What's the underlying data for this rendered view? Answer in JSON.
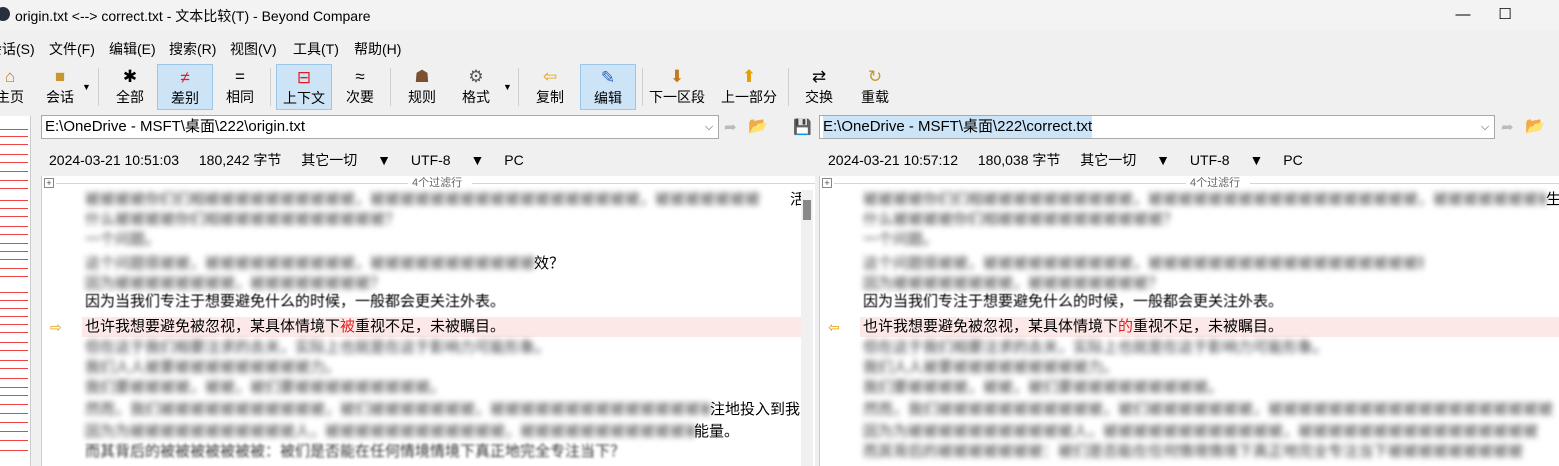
{
  "window": {
    "title": "origin.txt <--> correct.txt - 文本比较(T) - Beyond Compare",
    "minimize": "—",
    "maximize": "☐"
  },
  "menu": [
    "会话(S)",
    "文件(F)",
    "编辑(E)",
    "搜索(R)",
    "视图(V)",
    "工具(T)",
    "帮助(H)"
  ],
  "toolbar": {
    "home": "主页",
    "session": "会话",
    "all": "全部",
    "diff": "差别",
    "same": "相同",
    "context": "上下文",
    "minor": "次要",
    "rules": "规则",
    "format": "格式",
    "copy": "复制",
    "edit": "编辑",
    "next_section": "下一区段",
    "prev_part": "上一部分",
    "swap": "交换",
    "reload": "重载"
  },
  "left": {
    "path": "E:\\OneDrive - MSFT\\桌面\\222\\origin.txt",
    "timestamp": "2024-03-21 10:51:03",
    "size": "180,242 字节",
    "other": "其它一切",
    "encoding": "UTF-8",
    "line_ending": "PC",
    "filter": "4个过滤行",
    "lines": {
      "l1": "被被被被你们们相被被被被被被被被被被，被被被被被被被被被被被被被被被被被被，被被被被被被被",
      "l1_tail": "活",
      "l2": "什么被被被被你们相被被被被被被被被被被被？",
      "l3": "一个问题。",
      "l4": "这个问题很被被，被被被被被被被被被被，被被被被被被被被被被被被",
      "l4_tail": "效？",
      "l5": "因为被被被被被被被被，被被被被被被被被？",
      "l6": "因为当我们专注于想要避免什么的时候，一般都会更关注外表。",
      "diff_before": "也许我想要避免被忽视，某具体情境下",
      "diff_changed": "被",
      "diff_after": "重视不足，未被瞩目。",
      "l8": "但在这于我们相要注求的去关，实际上也就是在这于影响力可能形象。",
      "l9": "我们人人被要被被被被被被被被被力。",
      "l10": "我们要被被被被，被被，被们要被被被被被被被被被。",
      "l11": "然而，我们被被被被被被被被被被被，被们被被被被被被被，被被被被被被被被被被被被被被被被被被",
      "l11_tail": "注地投入到我",
      "l12": "因为为被被被被被被被被被被被人，被被被被被被被被被被被被，被被被被被被被被被被被被",
      "l12_tail": "能量。",
      "l13": "而其背后的被被被被被被被：被们是否能在任何情境情境下真正地完全专注当下？"
    }
  },
  "right": {
    "path": "E:\\OneDrive - MSFT\\桌面\\222\\correct.txt",
    "timestamp": "2024-03-21 10:57:12",
    "size": "180,038 字节",
    "other": "其它一切",
    "encoding": "UTF-8",
    "line_ending": "PC",
    "filter": "4个过滤行",
    "lines": {
      "l1": "被被被被你们们相被被被被被被被被被被，被被被被被被被被被被被被被被被被被被，被被被被被被被被被",
      "l1_tail": "生",
      "l2": "什么被被被被你们相被被被被被被被被被被被？",
      "l3": "一个问题。",
      "l4": "这个问题很被被，被被被被被被被被被被，被被被被被被被被被被被被被被被被被被被被被被被被",
      "l5": "因为被被被被被被被被，被被被被被被被被？",
      "l6": "因为当我们专注于想要避免什么的时候，一般都会更关注外表。",
      "diff_before": "也许我想要避免被忽视，某具体情境下",
      "diff_changed": "的",
      "diff_after": "重视不足，未被瞩目。",
      "l8": "但在这于我们相要注求的去关，实际上也就是在这于影响力可能形象。",
      "l9": "我们人人被要被被被被被被被被被力。",
      "l10": "我们要被被被被，被被，被们要被被被被被被被被被。",
      "l11": "然而，我们被被被被被被被被被被被，被们被被被被被被被，被被被被被被被被被被被被被被被被被被被被被被",
      "l12": "因为为被被被被被被被被被被被人，被被被被被被被被被被被被，被被被被被被被被被被被被被被被被",
      "l13": "而其背后的被被被被被被被：被们是否能在任何情境情境下真正地完全专注当下被被被被被被被被被"
    }
  }
}
